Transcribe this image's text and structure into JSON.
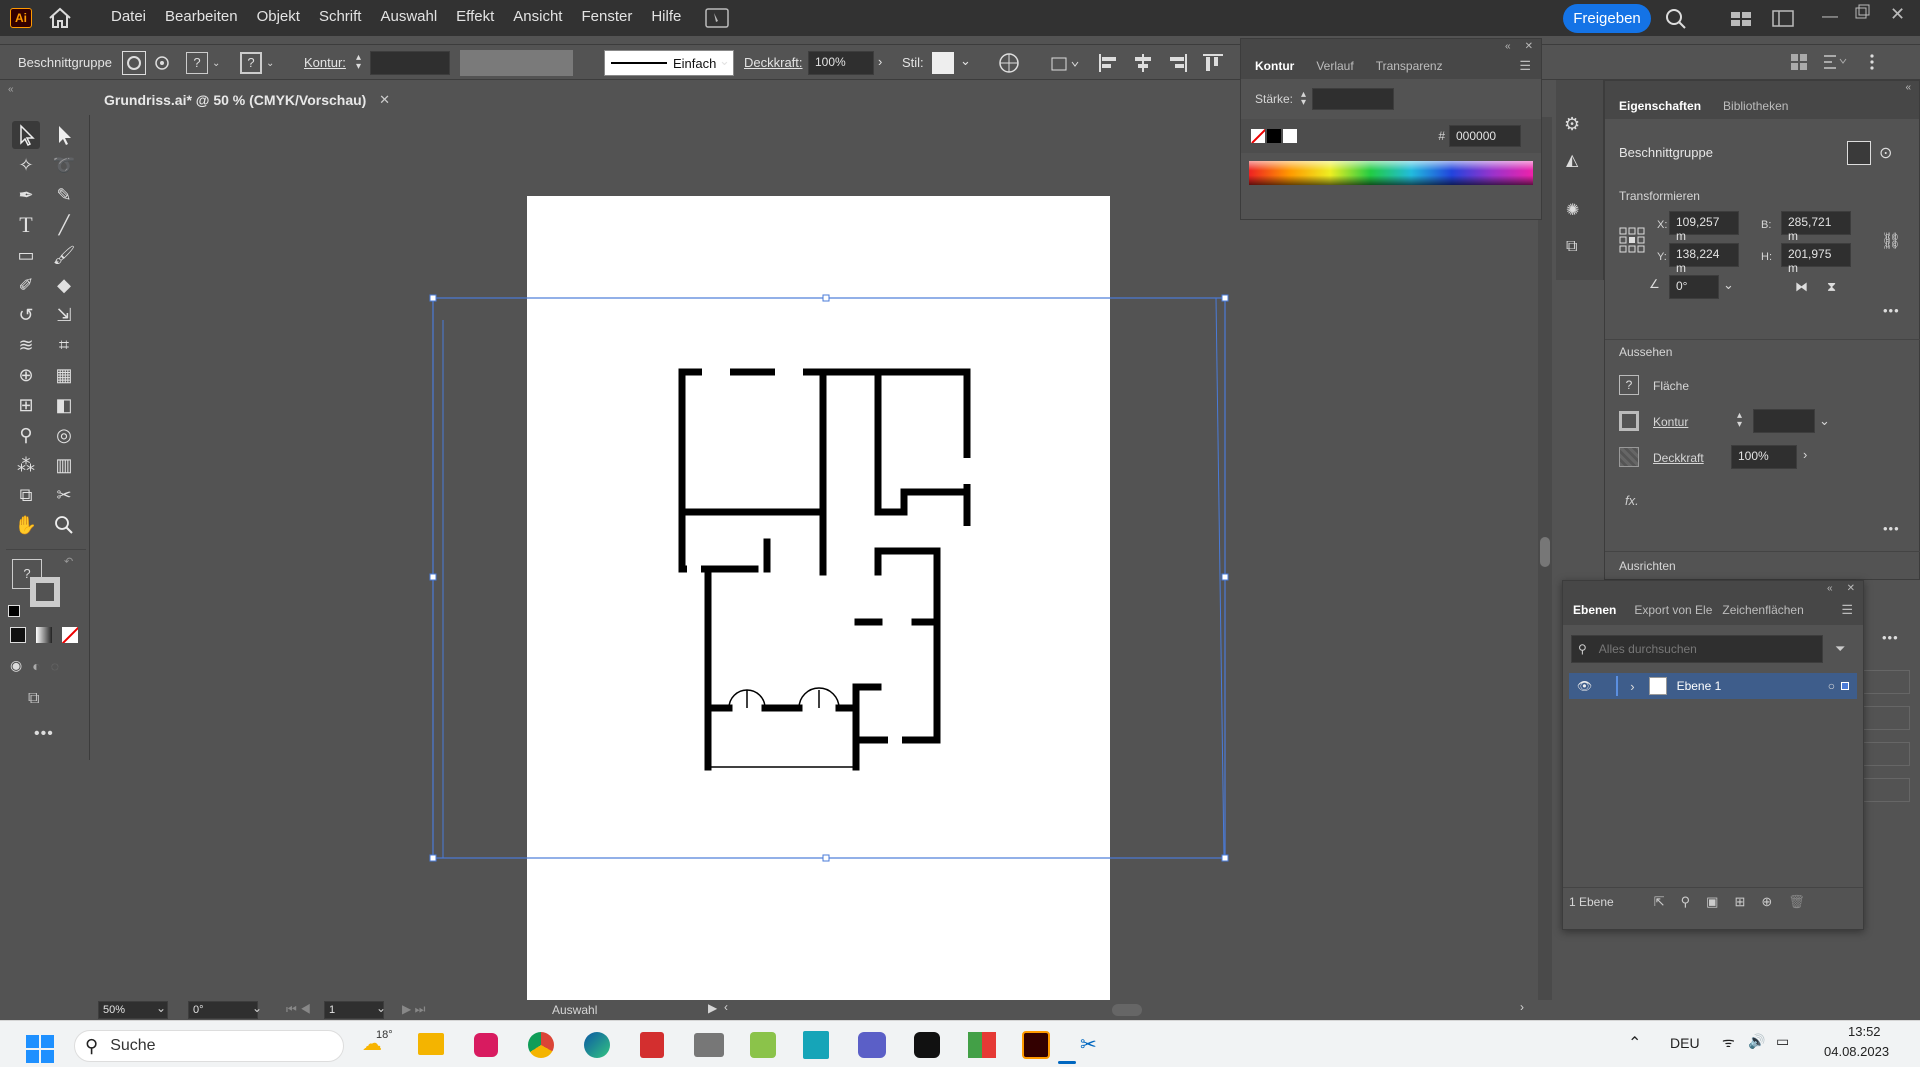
{
  "app": {
    "logo": "Ai",
    "home_icon": "home-icon"
  },
  "menu": [
    "Datei",
    "Bearbeiten",
    "Objekt",
    "Schrift",
    "Auswahl",
    "Effekt",
    "Ansicht",
    "Fenster",
    "Hilfe"
  ],
  "share_label": "Freigeben",
  "control": {
    "selection_type": "Beschnittgruppe",
    "stroke_label": "Kontur:",
    "stroke_style": "Einfach",
    "opacity_label": "Deckkraft:",
    "opacity_value": "100%",
    "style_label": "Stil:"
  },
  "document": {
    "tab_title": "Grundriss.ai* @ 50 % (CMYK/Vorschau)"
  },
  "stroke_panel": {
    "tabs": [
      "Kontur",
      "Verlauf",
      "Transparenz"
    ],
    "weight_label": "Stärke:",
    "hex_prefix": "#",
    "hex_value": "000000"
  },
  "properties": {
    "tabs": [
      "Eigenschaften",
      "Bibliotheken"
    ],
    "object_type": "Beschnittgruppe",
    "transform_title": "Transformieren",
    "x_label": "X:",
    "x_value": "109,257 m",
    "y_label": "Y:",
    "y_value": "138,224 m",
    "w_label": "B:",
    "w_value": "285,721 m",
    "h_label": "H:",
    "h_value": "201,975 m",
    "angle_value": "0°",
    "appearance_title": "Aussehen",
    "fill_label": "Fläche",
    "stroke_label": "Kontur",
    "opacity_label": "Deckkraft",
    "opacity_value": "100%",
    "fx_label": "fx.",
    "align_title": "Ausrichten"
  },
  "layers": {
    "tabs": [
      "Ebenen",
      "Export von Ele",
      "Zeichenflächen"
    ],
    "search_placeholder": "Alles durchsuchen",
    "layer_name": "Ebene 1",
    "count_label": "1 Ebene"
  },
  "status": {
    "zoom": "50%",
    "rotation": "0°",
    "artboard_index": "1",
    "tool_name": "Auswahl"
  },
  "taskbar": {
    "search_label": "Suche",
    "weather": "18°",
    "language": "DEU",
    "time": "13:52",
    "date": "04.08.2023"
  },
  "colors": {
    "accent": "#1473e6",
    "selection": "#4a7bd8",
    "panel": "#535353",
    "menubar": "#323232"
  }
}
